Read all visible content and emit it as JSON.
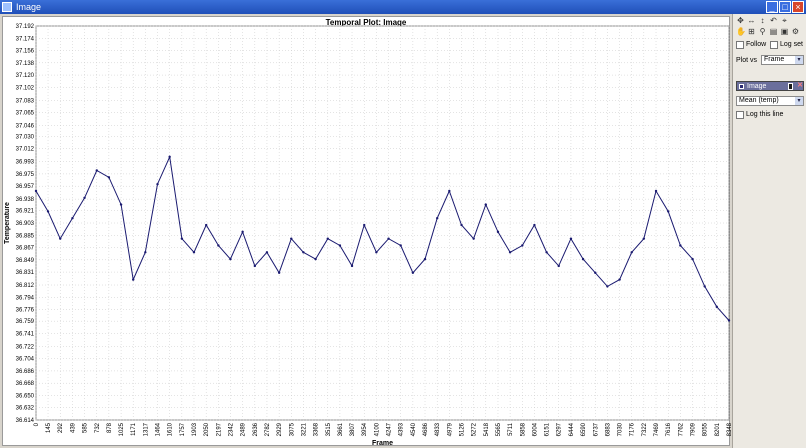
{
  "window": {
    "title": "Image"
  },
  "sidebar": {
    "follow_label": "Follow",
    "logset_label": "Log set",
    "plot_vs_label": "Plot vs",
    "plot_vs_value": "Frame",
    "series_name": "Image",
    "stat_value": "Mean (temp)",
    "log_line_label": "Log this line"
  },
  "chart_data": {
    "type": "line",
    "title": "Temporal Plot: Image",
    "xlabel": "Frame",
    "ylabel": "Temperature",
    "ylim": [
      36.614,
      37.192
    ],
    "yticks": [
      "37.192",
      "37.174",
      "37.156",
      "37.138",
      "37.120",
      "37.102",
      "37.083",
      "37.065",
      "37.046",
      "37.030",
      "37.012",
      "36.993",
      "36.975",
      "36.957",
      "36.938",
      "36.921",
      "36.903",
      "36.885",
      "36.867",
      "36.849",
      "36.831",
      "36.812",
      "36.794",
      "36.776",
      "36.759",
      "36.741",
      "36.722",
      "36.704",
      "36.686",
      "36.668",
      "36.650",
      "36.632",
      "36.614"
    ],
    "xticks": [
      "0",
      "145",
      "292",
      "439",
      "585",
      "732",
      "878",
      "1025",
      "1171",
      "1317",
      "1464",
      "1610",
      "1757",
      "1903",
      "2050",
      "2197",
      "2342",
      "2489",
      "2636",
      "2782",
      "2929",
      "3075",
      "3221",
      "3368",
      "3515",
      "3661",
      "3807",
      "3954",
      "4100",
      "4247",
      "4393",
      "4540",
      "4686",
      "4833",
      "4979",
      "5126",
      "5272",
      "5418",
      "5565",
      "5711",
      "5858",
      "6004",
      "6151",
      "6297",
      "6444",
      "6590",
      "6737",
      "6883",
      "7030",
      "7176",
      "7322",
      "7469",
      "7616",
      "7762",
      "7909",
      "8055",
      "8201",
      "8348"
    ],
    "series": [
      {
        "color": "#1a1a70",
        "x": [
          0,
          145,
          292,
          439,
          585,
          732,
          878,
          1025,
          1171,
          1317,
          1464,
          1610,
          1757,
          1903,
          2050,
          2197,
          2342,
          2489,
          2636,
          2782,
          2929,
          3075,
          3221,
          3368,
          3515,
          3661,
          3807,
          3954,
          4100,
          4247,
          4393,
          4540,
          4686,
          4833,
          4979,
          5126,
          5272,
          5418,
          5565,
          5711,
          5858,
          6004,
          6151,
          6297,
          6444,
          6590,
          6737,
          6883,
          7030,
          7176,
          7322,
          7469,
          7616,
          7762,
          7909,
          8055,
          8201,
          8348
        ],
        "values": [
          36.95,
          36.92,
          36.88,
          36.91,
          36.94,
          36.98,
          36.97,
          36.93,
          36.82,
          36.86,
          36.96,
          37.0,
          36.88,
          36.86,
          36.9,
          36.87,
          36.85,
          36.89,
          36.84,
          36.86,
          36.83,
          36.88,
          36.86,
          36.85,
          36.88,
          36.87,
          36.84,
          36.9,
          36.86,
          36.88,
          36.87,
          36.83,
          36.85,
          36.91,
          36.95,
          36.9,
          36.88,
          36.93,
          36.89,
          36.86,
          36.87,
          36.9,
          36.86,
          36.84,
          36.88,
          36.85,
          36.83,
          36.81,
          36.82,
          36.86,
          36.88,
          36.95,
          36.92,
          36.87,
          36.85,
          36.81,
          36.78,
          36.76
        ]
      }
    ]
  }
}
